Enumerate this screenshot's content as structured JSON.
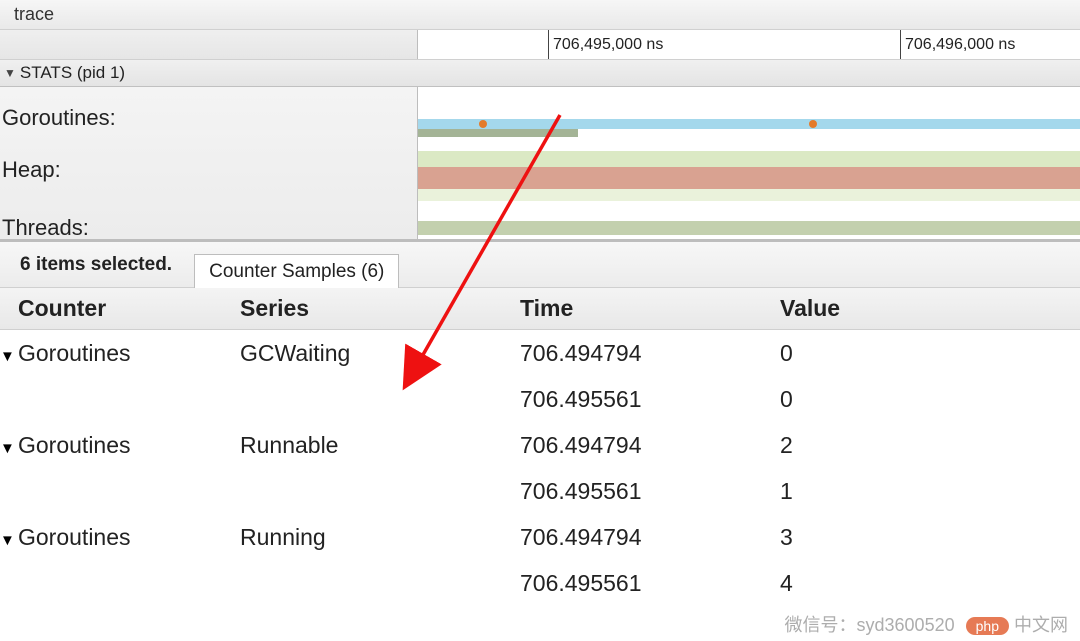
{
  "app_title": "trace",
  "ruler_ticks": [
    "706,495,000 ns",
    "706,496,000 ns"
  ],
  "stats_header": "STATS (pid 1)",
  "track_labels": [
    "Goroutines:",
    "Heap:",
    "Threads:"
  ],
  "detail": {
    "selected_text": "6 items selected.",
    "tab_label": "Counter Samples (6)",
    "columns": [
      "Counter",
      "Series",
      "Time",
      "Value"
    ],
    "rows": [
      {
        "counter": "Goroutines",
        "series": "GCWaiting",
        "time": "706.494794",
        "value": "0",
        "expandable": true
      },
      {
        "counter": "",
        "series": "",
        "time": "706.495561",
        "value": "0",
        "expandable": false
      },
      {
        "counter": "Goroutines",
        "series": "Runnable",
        "time": "706.494794",
        "value": "2",
        "expandable": true
      },
      {
        "counter": "",
        "series": "",
        "time": "706.495561",
        "value": "1",
        "expandable": false
      },
      {
        "counter": "Goroutines",
        "series": "Running",
        "time": "706.494794",
        "value": "3",
        "expandable": true
      },
      {
        "counter": "",
        "series": "",
        "time": "706.495561",
        "value": "4",
        "expandable": false
      }
    ]
  },
  "watermark": {
    "wechat": "微信号：syd3600520",
    "site": "中文网",
    "badge": "php"
  }
}
